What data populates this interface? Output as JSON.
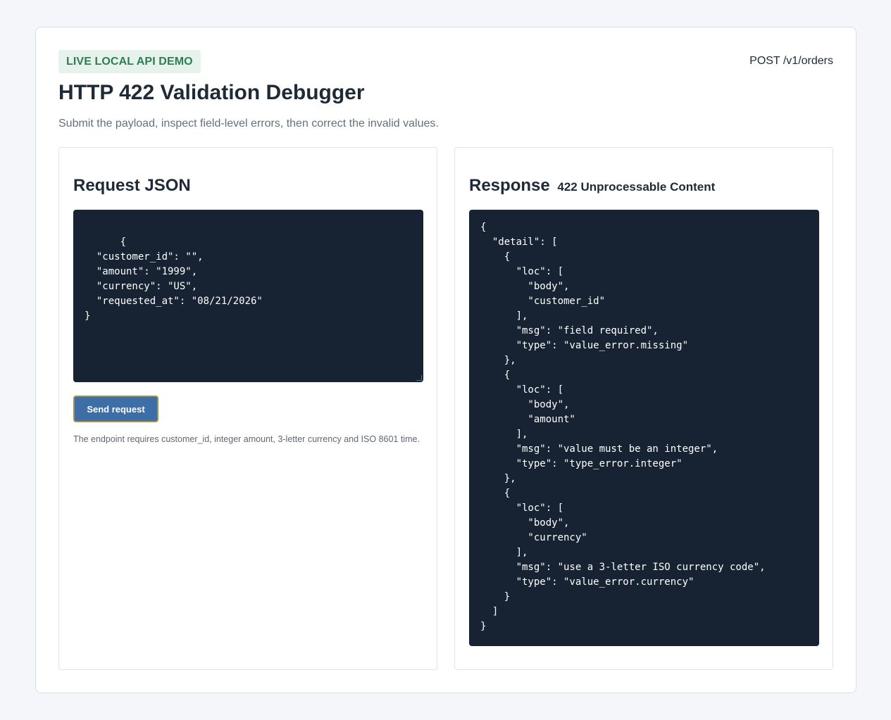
{
  "header": {
    "badge": "LIVE LOCAL API DEMO",
    "endpoint": "POST /v1/orders",
    "title": "HTTP 422 Validation Debugger",
    "subtitle": "Submit the payload, inspect field-level errors, then correct the invalid values."
  },
  "request": {
    "heading": "Request JSON",
    "body": "{\n  \"customer_id\": \"\",\n  \"amount\": \"1999\",\n  \"currency\": \"US\",\n  \"requested_at\": \"08/21/2026\"\n}",
    "send_label": "Send request",
    "hint": "The endpoint requires customer_id, integer amount, 3-letter currency and ISO 8601 time."
  },
  "response": {
    "heading": "Response",
    "status": "422 Unprocessable Content",
    "body": "{\n  \"detail\": [\n    {\n      \"loc\": [\n        \"body\",\n        \"customer_id\"\n      ],\n      \"msg\": \"field required\",\n      \"type\": \"value_error.missing\"\n    },\n    {\n      \"loc\": [\n        \"body\",\n        \"amount\"\n      ],\n      \"msg\": \"value must be an integer\",\n      \"type\": \"type_error.integer\"\n    },\n    {\n      \"loc\": [\n        \"body\",\n        \"currency\"\n      ],\n      \"msg\": \"use a 3-letter ISO currency code\",\n      \"type\": \"value_error.currency\"\n    }\n  ]\n}"
  },
  "colors": {
    "badge_bg": "#e6f3ec",
    "badge_text": "#2f7d54",
    "code_bg": "#172333",
    "button_bg": "#3d6ea5",
    "button_focus_ring": "#a8914d"
  }
}
